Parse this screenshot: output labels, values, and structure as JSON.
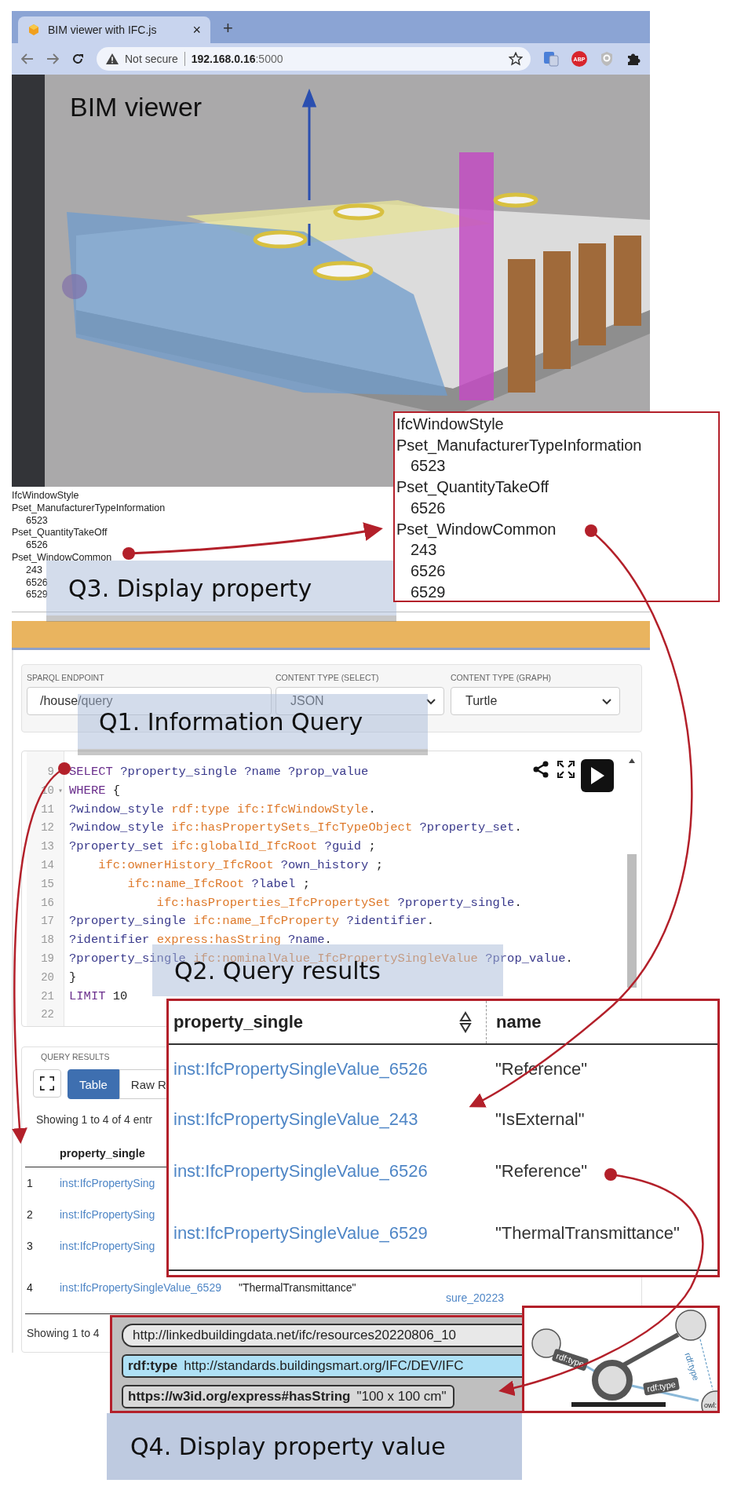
{
  "browser": {
    "tab": {
      "title": "BIM viewer with IFC.js",
      "close": "×",
      "selected": true
    },
    "new_tab": "+",
    "security": "Not secure",
    "url_host": "192.168.0.16",
    "url_port": ":5000",
    "extension_badge": "ABP"
  },
  "viewer": {
    "title": "BIM viewer"
  },
  "property_list": {
    "type": "IfcWindowStyle",
    "sets": [
      {
        "name": "Pset_ManufacturerTypeInformation",
        "values": [
          "6523"
        ]
      },
      {
        "name": "Pset_QuantityTakeOff",
        "values": [
          "6526"
        ]
      },
      {
        "name": "Pset_WindowCommon",
        "values": [
          "243",
          "6526",
          "6529"
        ]
      }
    ]
  },
  "sparql_form": {
    "fields": [
      {
        "label": "SPARQL ENDPOINT",
        "value": "/house/query",
        "kind": "input"
      },
      {
        "label": "CONTENT TYPE (SELECT)",
        "value": "JSON",
        "kind": "select"
      },
      {
        "label": "CONTENT TYPE (GRAPH)",
        "value": "Turtle",
        "kind": "select"
      }
    ]
  },
  "editor": {
    "lines": [
      {
        "number": "9",
        "tokens": [
          {
            "kind": "keyword",
            "text": "SELECT "
          },
          {
            "kind": "var",
            "text": "?property_single ?name ?prop_value"
          }
        ]
      },
      {
        "number": "10",
        "fold": "▾",
        "tokens": [
          {
            "kind": "keyword",
            "text": "WHERE "
          },
          {
            "kind": "plain",
            "text": "{"
          }
        ]
      },
      {
        "number": "11",
        "tokens": [
          {
            "kind": "var",
            "text": "?window_style "
          },
          {
            "kind": "iri",
            "text": "rdf:type ifc:IfcWindowStyle"
          },
          {
            "kind": "plain",
            "text": "."
          }
        ]
      },
      {
        "number": "12",
        "tokens": [
          {
            "kind": "var",
            "text": "?window_style "
          },
          {
            "kind": "iri",
            "text": "ifc:hasPropertySets_IfcTypeObject "
          },
          {
            "kind": "var",
            "text": "?property_set"
          },
          {
            "kind": "plain",
            "text": "."
          }
        ]
      },
      {
        "number": "13",
        "tokens": [
          {
            "kind": "var",
            "text": "?property_set "
          },
          {
            "kind": "iri",
            "text": "ifc:globalId_IfcRoot "
          },
          {
            "kind": "var",
            "text": "?guid "
          },
          {
            "kind": "plain",
            "text": ";"
          }
        ]
      },
      {
        "number": "14",
        "tokens": [
          {
            "kind": "iri",
            "text": "    ifc:ownerHistory_IfcRoot "
          },
          {
            "kind": "var",
            "text": "?own_history "
          },
          {
            "kind": "plain",
            "text": ";"
          }
        ]
      },
      {
        "number": "15",
        "tokens": [
          {
            "kind": "iri",
            "text": "        ifc:name_IfcRoot "
          },
          {
            "kind": "var",
            "text": "?label "
          },
          {
            "kind": "plain",
            "text": ";"
          }
        ]
      },
      {
        "number": "16",
        "tokens": [
          {
            "kind": "iri",
            "text": "            ifc:hasProperties_IfcPropertySet "
          },
          {
            "kind": "var",
            "text": "?property_single"
          },
          {
            "kind": "plain",
            "text": "."
          }
        ]
      },
      {
        "number": "17",
        "tokens": [
          {
            "kind": "var",
            "text": "?property_single "
          },
          {
            "kind": "iri",
            "text": "ifc:name_IfcProperty "
          },
          {
            "kind": "var",
            "text": "?identifier"
          },
          {
            "kind": "plain",
            "text": "."
          }
        ]
      },
      {
        "number": "18",
        "tokens": [
          {
            "kind": "var",
            "text": "?identifier "
          },
          {
            "kind": "iri",
            "text": "express:hasString "
          },
          {
            "kind": "var",
            "text": "?name"
          },
          {
            "kind": "plain",
            "text": "."
          }
        ]
      },
      {
        "number": "19",
        "tokens": [
          {
            "kind": "var",
            "text": "?property_single "
          },
          {
            "kind": "iri",
            "text": "ifc:nominalValue_IfcPropertySingleValue "
          },
          {
            "kind": "var",
            "text": "?prop_value"
          },
          {
            "kind": "plain",
            "text": "."
          }
        ]
      },
      {
        "number": "20",
        "tokens": [
          {
            "kind": "plain",
            "text": "}"
          }
        ]
      },
      {
        "number": "21",
        "tokens": [
          {
            "kind": "keyword",
            "text": "LIMIT "
          },
          {
            "kind": "plain",
            "text": "10"
          }
        ]
      },
      {
        "number": "22"
      }
    ]
  },
  "query_results": {
    "heading": "QUERY RESULTS",
    "tabs": [
      {
        "label": "Table",
        "selected": true
      },
      {
        "label": "Raw R",
        "selected": false
      }
    ],
    "info": "Showing 1 to 4 of 4 entr",
    "column": "property_single",
    "rows": [
      {
        "number": "1",
        "value": "inst:IfcPropertySing"
      },
      {
        "number": "2",
        "value": "inst:IfcPropertySing"
      },
      {
        "number": "3",
        "value": "inst:IfcPropertySing"
      },
      {
        "number": "4",
        "value": "inst:IfcPropertySingleValue_6529",
        "name": "\"ThermalTransmittance\""
      }
    ],
    "fragment": "sure_20223",
    "footer": "Showing 1 to 4"
  },
  "property_callout": {
    "type": "IfcWindowStyle",
    "sets": [
      {
        "name": "Pset_ManufacturerTypeInformation",
        "values": [
          "6523"
        ]
      },
      {
        "name": "Pset_QuantityTakeOff",
        "values": [
          "6526"
        ]
      },
      {
        "name": "Pset_WindowCommon",
        "values": [
          "243",
          "6526",
          "6529"
        ]
      }
    ]
  },
  "results_callout": {
    "columns": [
      "property_single",
      "name"
    ],
    "rows": [
      {
        "value": "inst:IfcPropertySingleValue_6526",
        "name": "\"Reference\""
      },
      {
        "value": "inst:IfcPropertySingleValue_243",
        "name": "\"IsExternal\""
      },
      {
        "value": "inst:IfcPropertySingleValue_6526",
        "name": "\"Reference\""
      },
      {
        "value": "inst:IfcPropertySingleValue_6529",
        "name": "\"ThermalTransmittance\""
      }
    ]
  },
  "value_callout": {
    "pills": [
      {
        "kind": "uri",
        "text": "http://linkedbuildingdata.net/ifc/resources20220806_10"
      },
      {
        "kind": "type",
        "label": "rdf:type",
        "text": "http://standards.buildingsmart.org/IFC/DEV/IFC"
      },
      {
        "kind": "literal",
        "label": "https://w3id.org/express#hasString",
        "text": "\"100 x 100 cm\""
      }
    ]
  },
  "graph_callout": {
    "edge_labels": [
      "rdf:type",
      "rdf:type",
      "rdf:type"
    ],
    "node_label": "owl:"
  },
  "annotations": [
    "Q3. Display property",
    "Q1. Information Query",
    "Q2. Query results",
    "Q4. Display property value"
  ]
}
